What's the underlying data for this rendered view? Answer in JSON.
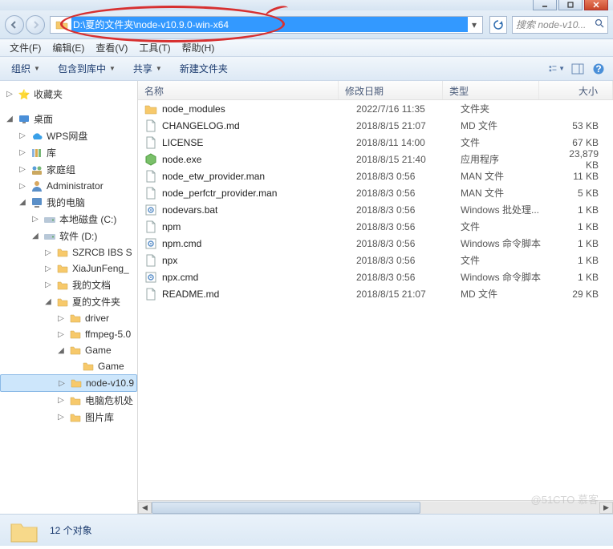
{
  "address": {
    "path": "D:\\夏的文件夹\\node-v10.9.0-win-x64",
    "search_placeholder": "搜索 node-v10..."
  },
  "menu": {
    "file": "文件(F)",
    "edit": "编辑(E)",
    "view": "查看(V)",
    "tools": "工具(T)",
    "help": "帮助(H)"
  },
  "toolbar": {
    "organize": "组织",
    "include": "包含到库中",
    "share": "共享",
    "newfolder": "新建文件夹"
  },
  "sidebar": {
    "favorites": "收藏夹",
    "desktop": "桌面",
    "wps": "WPS网盘",
    "library": "库",
    "homegroup": "家庭组",
    "admin": "Administrator",
    "computer": "我的电脑",
    "drive_c": "本地磁盘 (C:)",
    "drive_d": "软件 (D:)",
    "items": [
      "SZRCB IBS S",
      "XiaJunFeng_",
      "我的文档",
      "夏的文件夹"
    ],
    "subitems": [
      "driver",
      "ffmpeg-5.0",
      "Game"
    ],
    "game_sub": "Game",
    "selected": "node-v10.9",
    "after": [
      "电脑危机处",
      "图片库"
    ]
  },
  "columns": {
    "name": "名称",
    "date": "修改日期",
    "type": "类型",
    "size": "大小"
  },
  "files": [
    {
      "icon": "folder",
      "name": "node_modules",
      "date": "2022/7/16 11:35",
      "type": "文件夹",
      "size": ""
    },
    {
      "icon": "file",
      "name": "CHANGELOG.md",
      "date": "2018/8/15 21:07",
      "type": "MD 文件",
      "size": "53 KB"
    },
    {
      "icon": "file",
      "name": "LICENSE",
      "date": "2018/8/11 14:00",
      "type": "文件",
      "size": "67 KB"
    },
    {
      "icon": "exe",
      "name": "node.exe",
      "date": "2018/8/15 21:40",
      "type": "应用程序",
      "size": "23,879 KB"
    },
    {
      "icon": "file",
      "name": "node_etw_provider.man",
      "date": "2018/8/3 0:56",
      "type": "MAN 文件",
      "size": "11 KB"
    },
    {
      "icon": "file",
      "name": "node_perfctr_provider.man",
      "date": "2018/8/3 0:56",
      "type": "MAN 文件",
      "size": "5 KB"
    },
    {
      "icon": "bat",
      "name": "nodevars.bat",
      "date": "2018/8/3 0:56",
      "type": "Windows 批处理...",
      "size": "1 KB"
    },
    {
      "icon": "file",
      "name": "npm",
      "date": "2018/8/3 0:56",
      "type": "文件",
      "size": "1 KB"
    },
    {
      "icon": "bat",
      "name": "npm.cmd",
      "date": "2018/8/3 0:56",
      "type": "Windows 命令脚本",
      "size": "1 KB"
    },
    {
      "icon": "file",
      "name": "npx",
      "date": "2018/8/3 0:56",
      "type": "文件",
      "size": "1 KB"
    },
    {
      "icon": "bat",
      "name": "npx.cmd",
      "date": "2018/8/3 0:56",
      "type": "Windows 命令脚本",
      "size": "1 KB"
    },
    {
      "icon": "file",
      "name": "README.md",
      "date": "2018/8/15 21:07",
      "type": "MD 文件",
      "size": "29 KB"
    }
  ],
  "status": {
    "count": "12 个对象"
  },
  "watermark": "@51CTO 慕客"
}
